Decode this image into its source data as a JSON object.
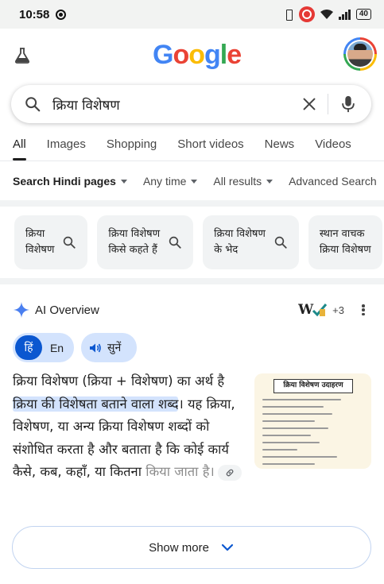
{
  "status_bar": {
    "time": "10:58",
    "battery": "40"
  },
  "header": {
    "logo": "Google",
    "labs_icon": "flask-icon",
    "avatar_icon": "user-avatar"
  },
  "search": {
    "query": "क्रिया विशेषण",
    "icons": [
      "search-icon",
      "clear-icon",
      "mic-icon"
    ]
  },
  "tabs": [
    {
      "label": "All",
      "active": true
    },
    {
      "label": "Images",
      "active": false
    },
    {
      "label": "Shopping",
      "active": false
    },
    {
      "label": "Short videos",
      "active": false
    },
    {
      "label": "News",
      "active": false
    },
    {
      "label": "Videos",
      "active": false
    }
  ],
  "filters": {
    "search_hindi": "Search Hindi pages",
    "any_time": "Any time",
    "all_results": "All results",
    "advanced": "Advanced Search"
  },
  "suggestions": [
    {
      "label": "क्रिया\nविशेषण"
    },
    {
      "label": "क्रिया विशेषण\nकिसे कहते हैं"
    },
    {
      "label": "क्रिया विशेषण\nके भेद"
    },
    {
      "label": "स्थान वाचक\nक्रिया विशेषण"
    }
  ],
  "ai_overview": {
    "title": "AI Overview",
    "source_more": "+3",
    "lang_hi": "हिं",
    "lang_en": "En",
    "listen": "सुनें",
    "text_part1": "क्रिया विशेषण (क्रिया + विशेषण) का अर्थ है ",
    "text_highlight": "क्रिया की विशेषता बताने वाला शब्द",
    "text_part2": "। यह क्रिया, विशेषण, या अन्य क्रिया विशेषण शब्दों को संशोधित करता है और बताता है कि कोई कार्य कैसे, कब, कहाँ, या कितना ",
    "text_faded": "किया जाता है।",
    "image_title": "क्रिया विशेषण उदाहरण",
    "show_more": "Show more"
  },
  "colors": {
    "accent_blue": "#0b57d0",
    "highlight": "#d3e3fd",
    "chip_bg": "#f1f3f4"
  }
}
